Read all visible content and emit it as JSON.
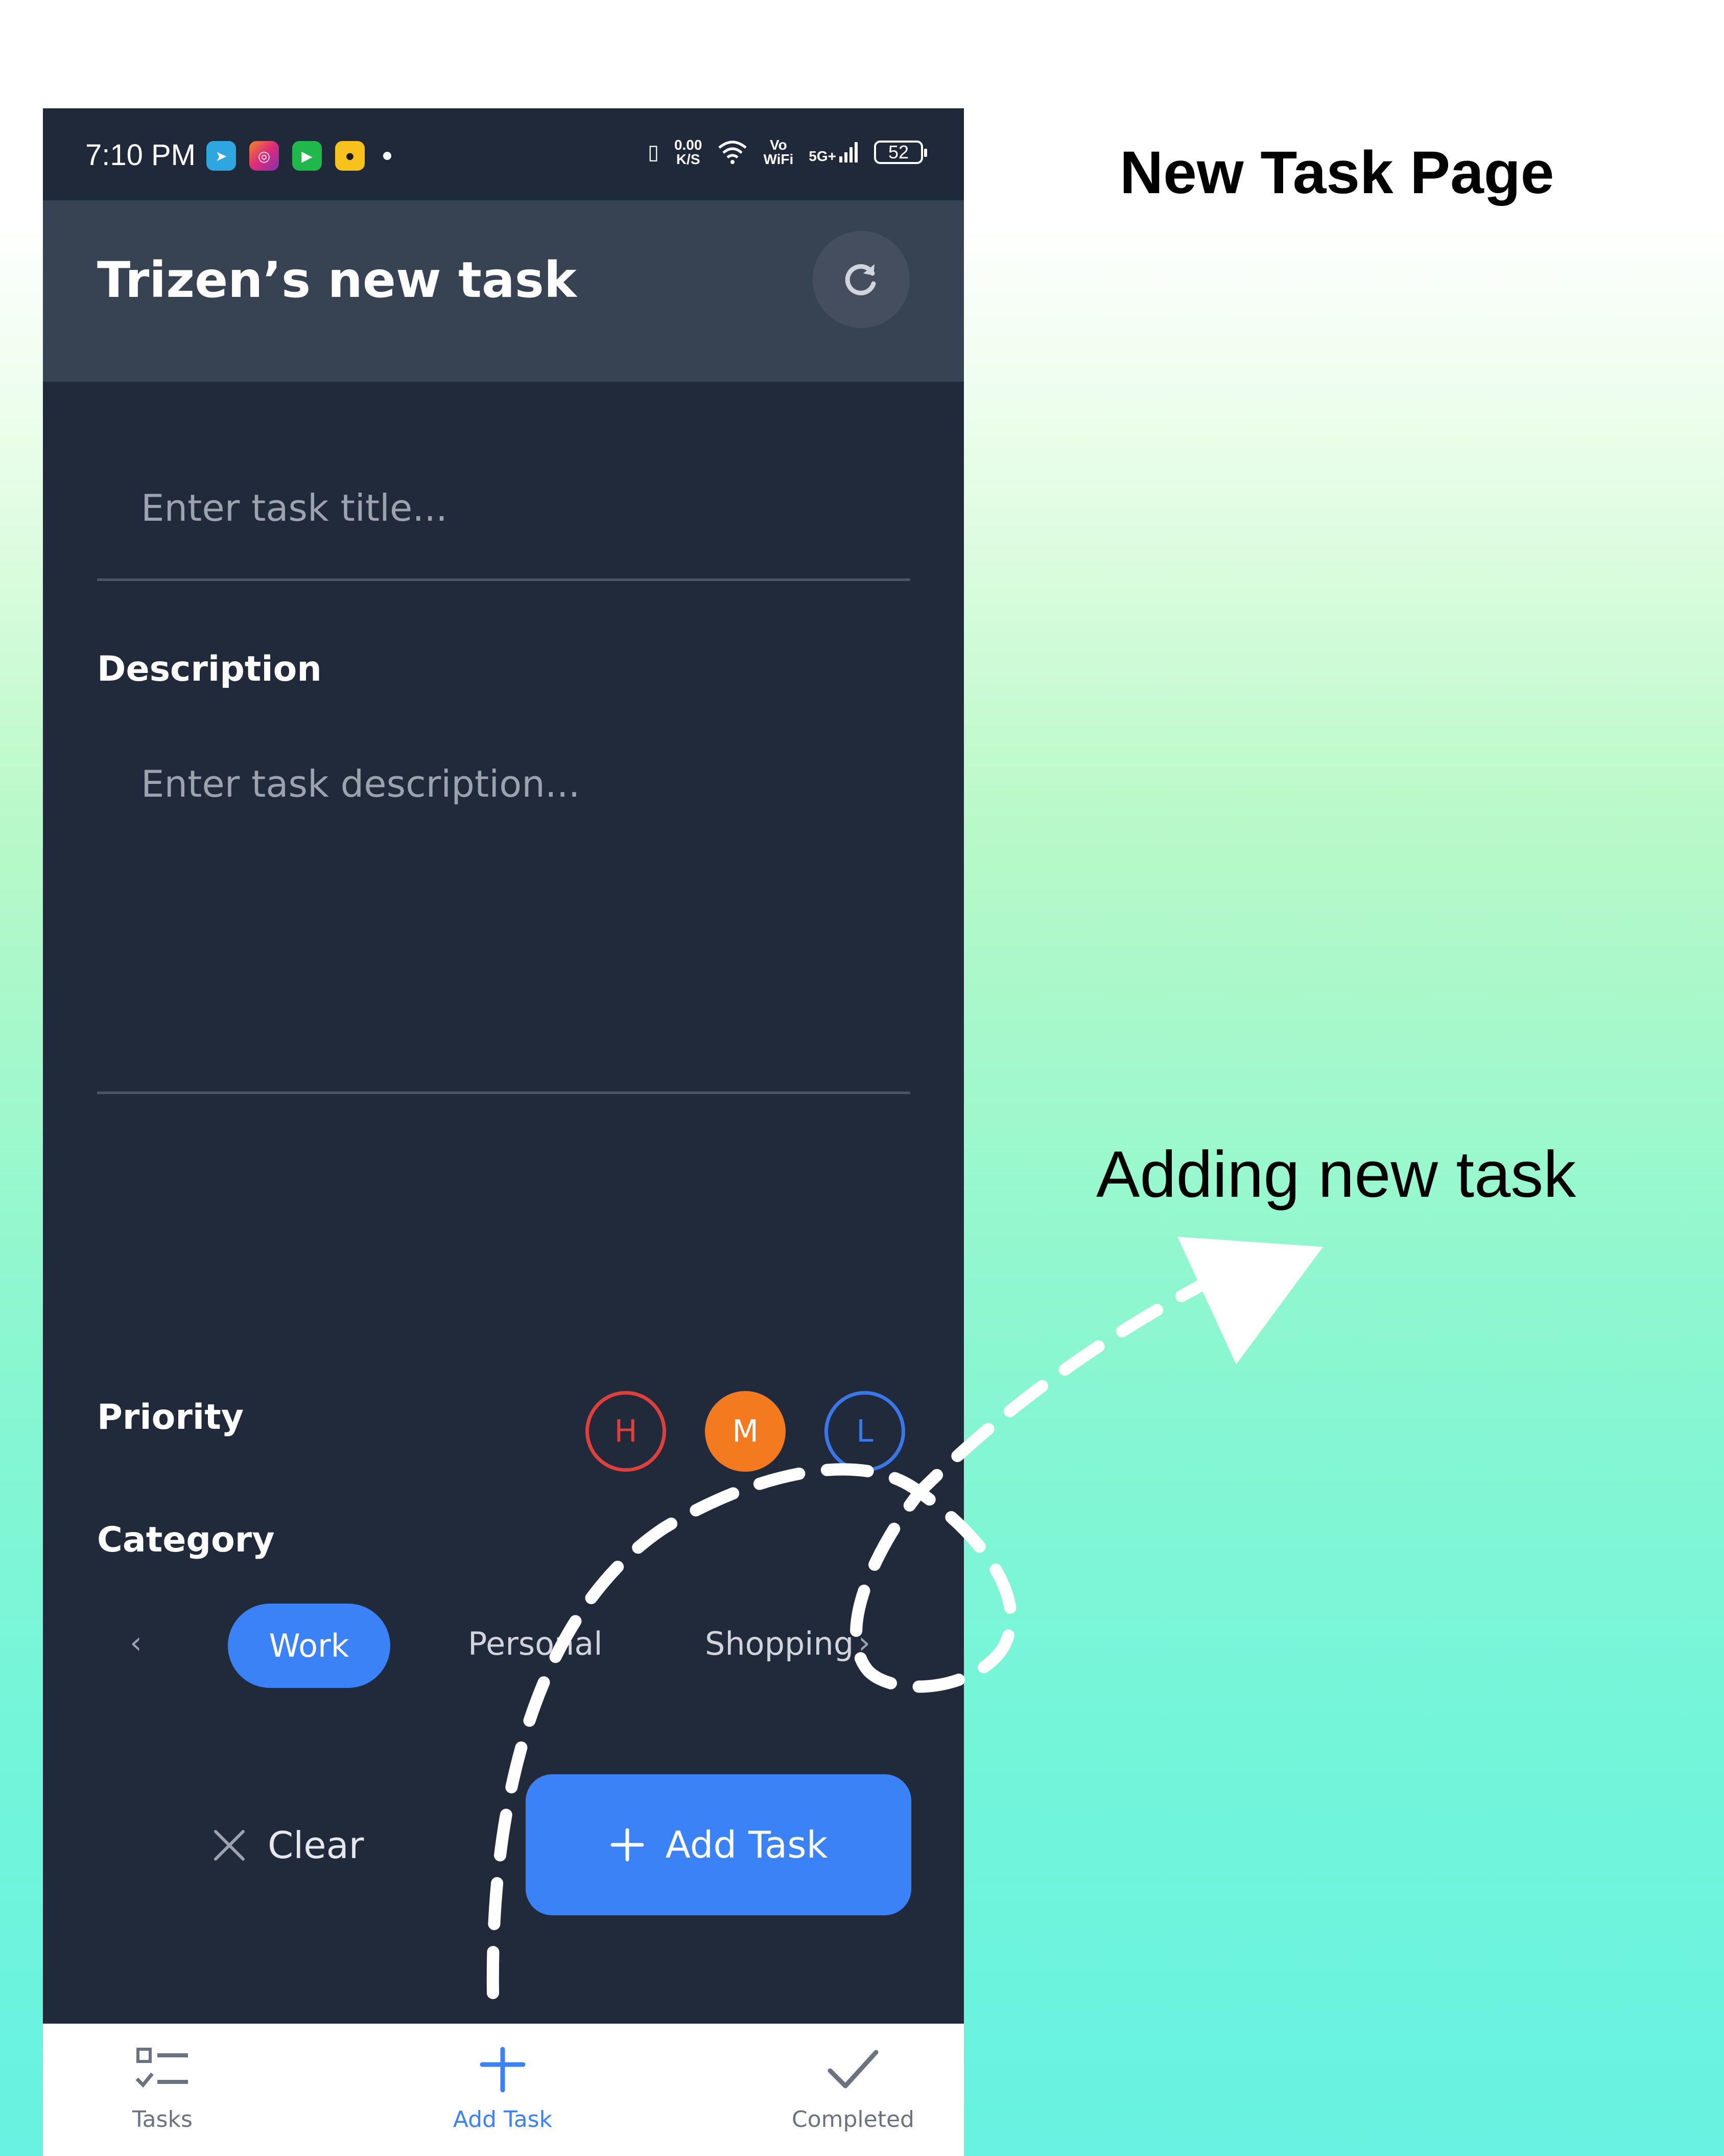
{
  "annotations": {
    "title": "New Task Page",
    "note": "Adding new task"
  },
  "status_bar": {
    "time": "7:10 PM",
    "speed_top": "0.00",
    "speed_bottom": "K/S",
    "vowifi_top": "Vo",
    "vowifi_bottom": "WiFi",
    "network": "5G+",
    "battery": "52"
  },
  "header": {
    "title": "Trizen’s new task"
  },
  "form": {
    "title_placeholder": "Enter task title...",
    "description_label": "Description",
    "description_placeholder": "Enter task description...",
    "priority_label": "Priority",
    "priorities": [
      "H",
      "M",
      "L"
    ],
    "category_label": "Category",
    "categories": [
      "Work",
      "Personal",
      "Shopping"
    ],
    "selected_category": "Work",
    "selected_priority": "M"
  },
  "actions": {
    "clear_label": "Clear",
    "add_label": "Add Task"
  },
  "bottom_nav": {
    "items": [
      "Tasks",
      "Add Task",
      "Completed"
    ],
    "active": "Add Task"
  },
  "colors": {
    "background": "#212a3b",
    "header": "#374252",
    "accent_blue": "#3b82f6",
    "priority_high": "#e0403b",
    "priority_medium": "#f47a1f",
    "priority_low": "#3a78ea"
  }
}
